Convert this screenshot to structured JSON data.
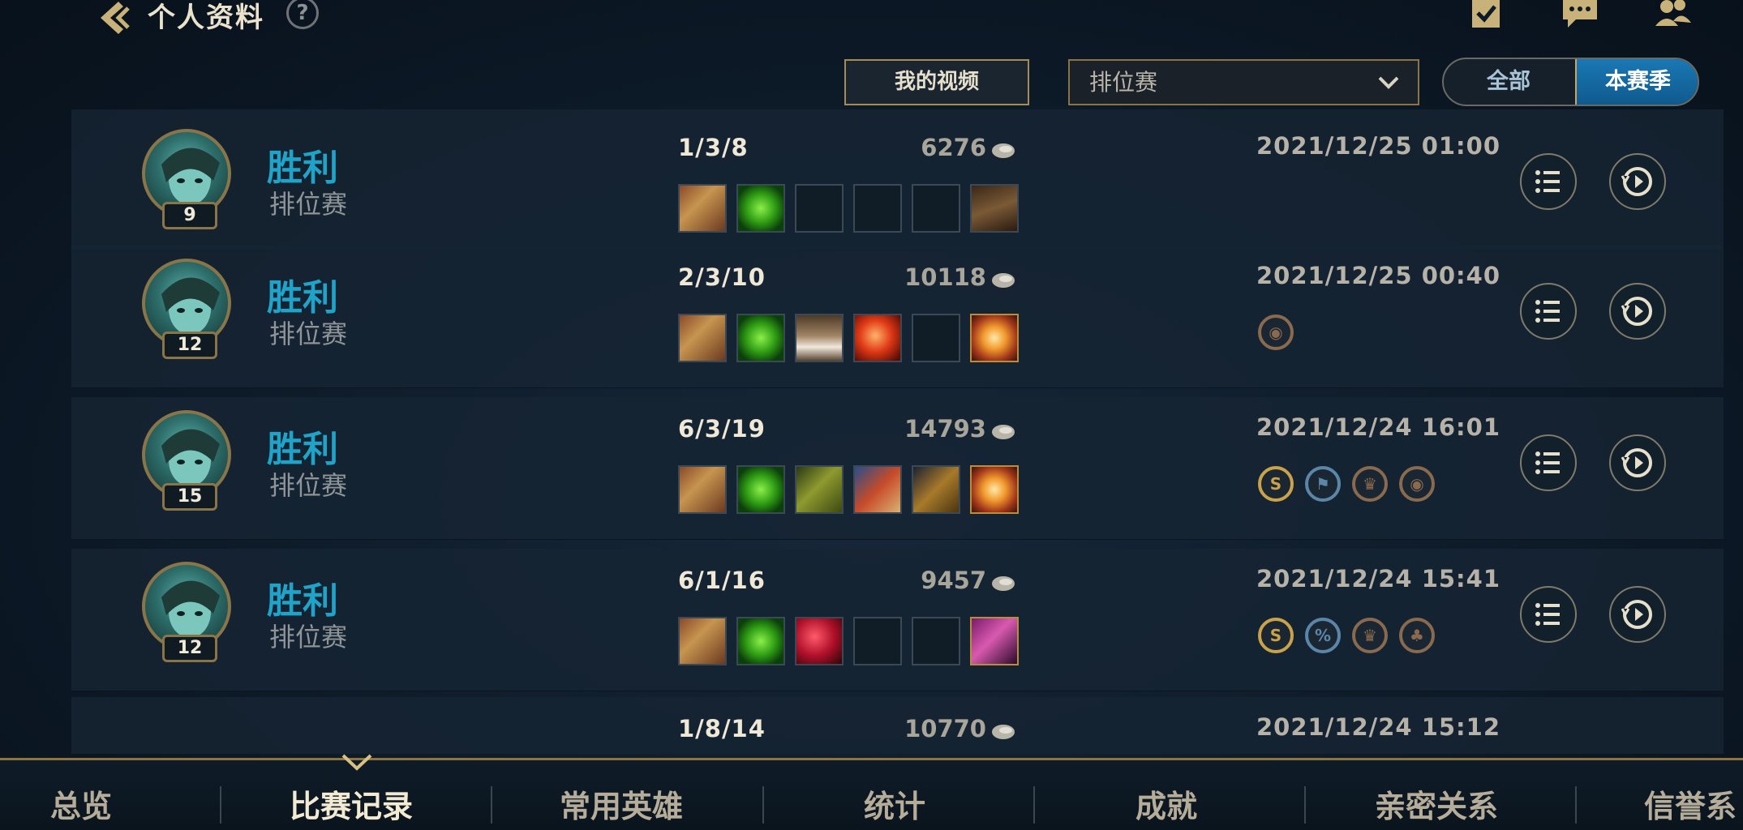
{
  "header": {
    "title": "个人资料",
    "help": "?"
  },
  "controls": {
    "my_videos": "我的视频",
    "queue_select": "排位赛",
    "toggle_all": "全部",
    "toggle_season": "本赛季"
  },
  "matches": [
    {
      "level": "9",
      "result": "胜利",
      "mode": "排位赛",
      "kda": "1/3/8",
      "gold": "6276",
      "date": "2021/12/25 01:00",
      "items": [
        "gauntlet",
        "green",
        "empty",
        "empty",
        "empty",
        "boots"
      ],
      "badges": []
    },
    {
      "level": "12",
      "result": "胜利",
      "mode": "排位赛",
      "kda": "2/3/10",
      "gold": "10118",
      "date": "2021/12/25 00:40",
      "items": [
        "gauntlet",
        "green",
        "belt",
        "red",
        "empty",
        "star"
      ],
      "badges": [
        "ward-badge"
      ]
    },
    {
      "level": "15",
      "result": "胜利",
      "mode": "排位赛",
      "kda": "6/3/19",
      "gold": "14793",
      "date": "2021/12/24 16:01",
      "items": [
        "gauntlet",
        "green",
        "olive",
        "armor",
        "gold",
        "star"
      ],
      "badges": [
        "s-rank-badge",
        "flag-badge",
        "crown-badge",
        "ward-badge"
      ]
    },
    {
      "level": "12",
      "result": "胜利",
      "mode": "排位赛",
      "kda": "6/1/16",
      "gold": "9457",
      "date": "2021/12/24 15:41",
      "items": [
        "gauntlet",
        "green",
        "crimson",
        "empty",
        "empty",
        "purple"
      ],
      "badges": [
        "s-rank-badge",
        "damage-badge",
        "crown-badge",
        "clover-badge"
      ]
    },
    {
      "level": "",
      "result": "",
      "mode": "",
      "kda": "1/8/14",
      "gold": "10770",
      "date": "2021/12/24 15:12",
      "items": [],
      "badges": []
    }
  ],
  "tabs": [
    "总览",
    "比赛记录",
    "常用英雄",
    "统计",
    "成就",
    "亲密关系",
    "信誉系"
  ],
  "active_tab": 1,
  "colors": {
    "victory": "#1fa3c9",
    "accent_gold": "#a58c55",
    "season_active": "#1a78b4"
  }
}
